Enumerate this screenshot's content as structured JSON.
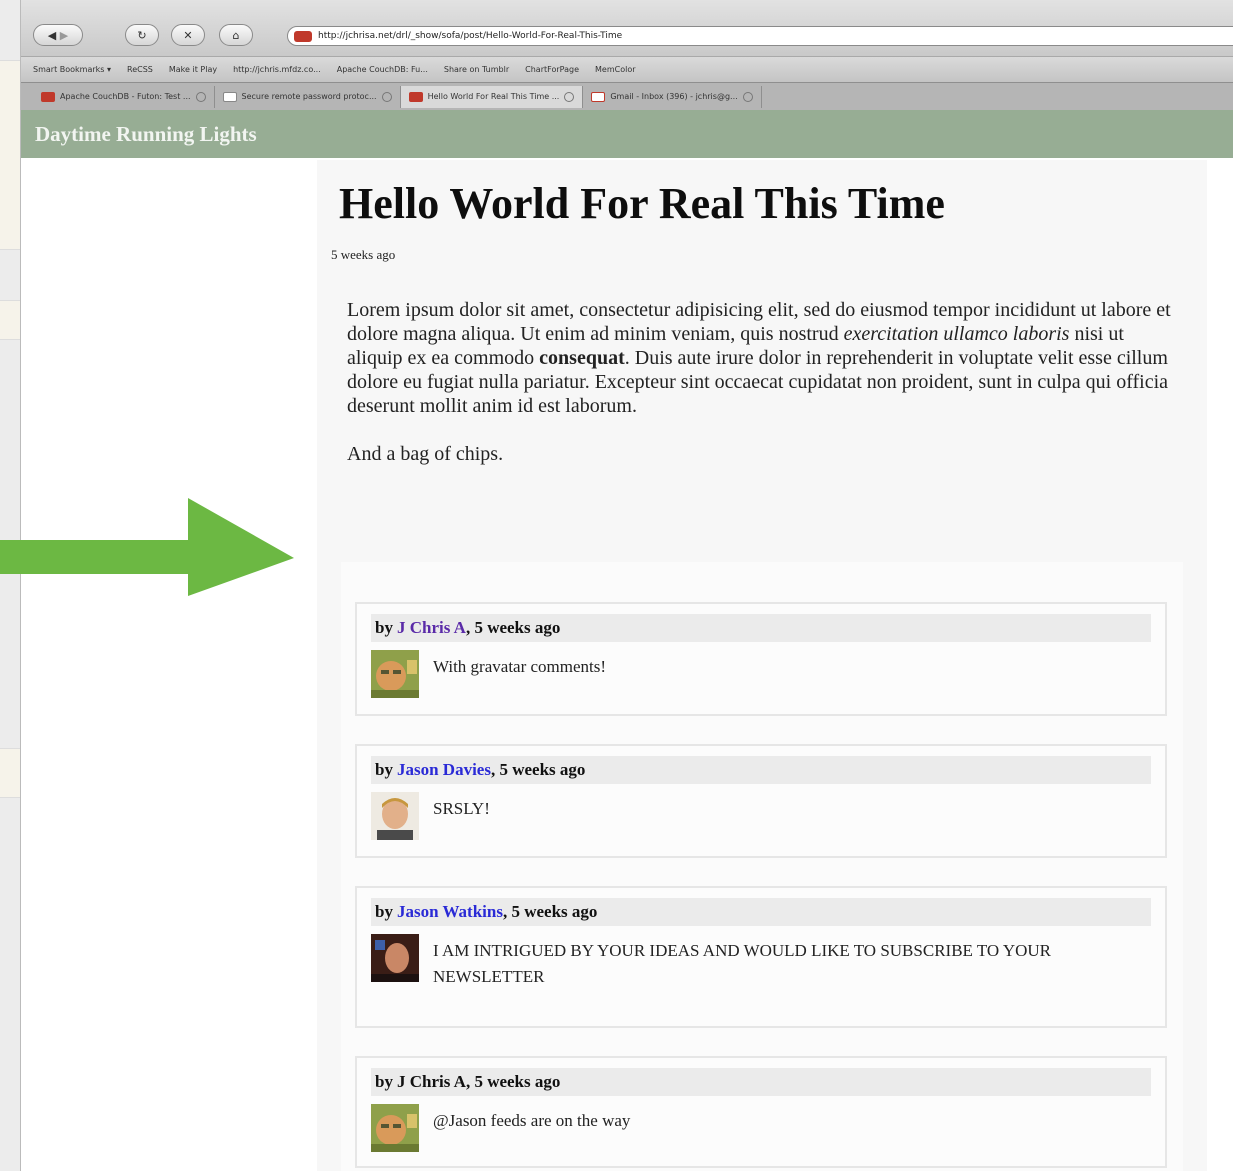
{
  "browser": {
    "url": "http://jchrisa.net/drl/_show/sofa/post/Hello-World-For-Real-This-Time",
    "bookmarks": [
      "Smart Bookmarks ▾",
      "ReCSS",
      "Make it Play",
      "http://jchris.mfdz.co...",
      "Apache CouchDB: Fu...",
      "Share on Tumblr",
      "ChartForPage",
      "MemColor"
    ],
    "tabs": [
      {
        "label": "Apache CouchDB - Futon: Test ...",
        "icon": "couchdb-icon"
      },
      {
        "label": "Secure remote password protoc...",
        "icon": "wikipedia-icon"
      },
      {
        "label": "Hello World For Real This Time ...",
        "icon": "couchdb-icon",
        "active": true
      },
      {
        "label": "Gmail - Inbox (396) - jchris@g...",
        "icon": "gmail-icon"
      }
    ]
  },
  "site": {
    "title": "Daytime Running Lights"
  },
  "post": {
    "title": "Hello World For Real This Time",
    "date": "5 weeks ago",
    "para1_a": "Lorem ipsum dolor sit amet, consectetur adipisicing elit, sed do eiusmod tempor incididunt ut labore et dolore magna aliqua. Ut enim ad minim veniam, quis nostrud ",
    "para1_em": "exercitation ullamco laboris",
    "para1_b": " nisi ut aliquip ex ea commodo ",
    "para1_strong": "consequat",
    "para1_c": ". Duis aute irure dolor in reprehenderit in voluptate velit esse cillum dolore eu fugiat nulla pariatur. Excepteur sint occaecat cupidatat non proident, sunt in culpa qui officia deserunt mollit anim id est laborum.",
    "para2": "And a bag of chips."
  },
  "comments": [
    {
      "by": "by",
      "author": "J Chris A",
      "sep": ",",
      "time": "5 weeks ago",
      "text": "With gravatar comments!"
    },
    {
      "by": "by",
      "author": "Jason Davies",
      "sep": ",",
      "time": "5 weeks ago",
      "text": "SRSLY!"
    },
    {
      "by": "by",
      "author": "Jason Watkins",
      "sep": ",",
      "time": "5 weeks ago",
      "text": "I AM INTRIGUED BY YOUR IDEAS AND WOULD LIKE TO SUBSCRIBE TO YOUR NEWSLETTER"
    },
    {
      "by": "by",
      "author": "J Chris A",
      "sep": ",",
      "time": "5 weeks ago",
      "text": "@Jason feeds are on the way"
    }
  ],
  "colors": {
    "header": "#97ad94",
    "arrow": "#6cb843",
    "link": "#2a2ad6"
  }
}
